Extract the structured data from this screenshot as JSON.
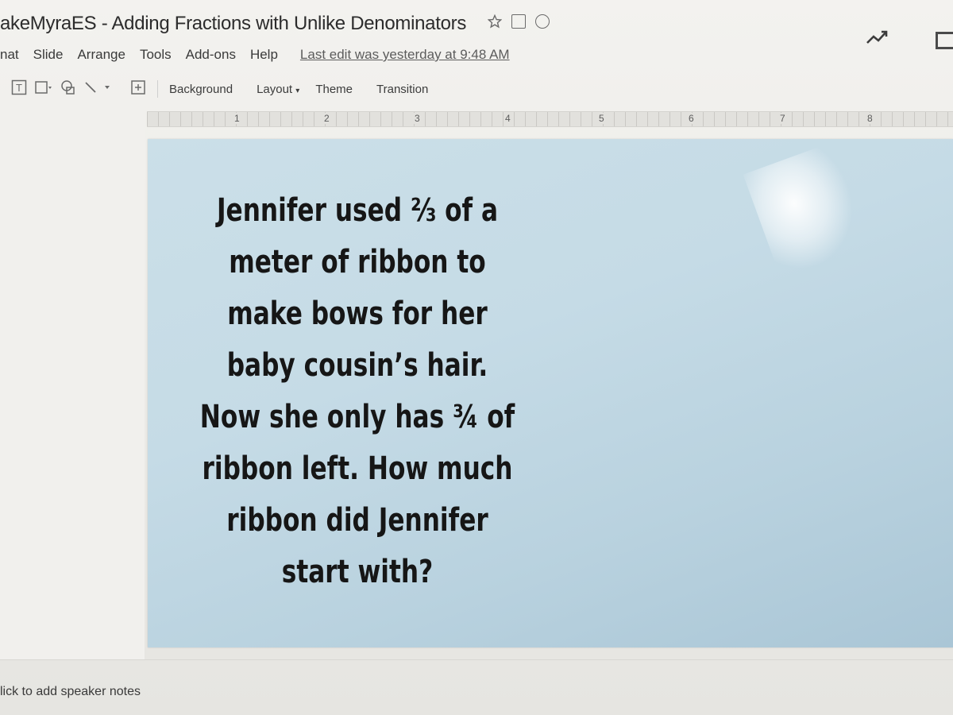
{
  "window": {
    "title": "akeMyraES - Adding Fractions with Unlike Denominators"
  },
  "menu": {
    "items": [
      "nat",
      "Slide",
      "Arrange",
      "Tools",
      "Add-ons",
      "Help"
    ],
    "last_edit": "Last edit was yesterday at 9:48 AM"
  },
  "toolbar": {
    "background_label": "Background",
    "layout_label": "Layout",
    "theme_label": "Theme",
    "transition_label": "Transition"
  },
  "ruler": {
    "numbers": [
      "1",
      "2",
      "3",
      "4",
      "5",
      "6",
      "7",
      "8"
    ]
  },
  "slide": {
    "lines": [
      "Jennifer used ⅔ of a",
      "meter of ribbon to",
      "make bows for her",
      "baby cousin’s hair.",
      "Now she only has ¾ of",
      "ribbon left.  How much",
      "ribbon did Jennifer",
      "start with?"
    ],
    "background_color": "#c5dbe6"
  },
  "notes": {
    "placeholder": "lick to add speaker notes"
  }
}
